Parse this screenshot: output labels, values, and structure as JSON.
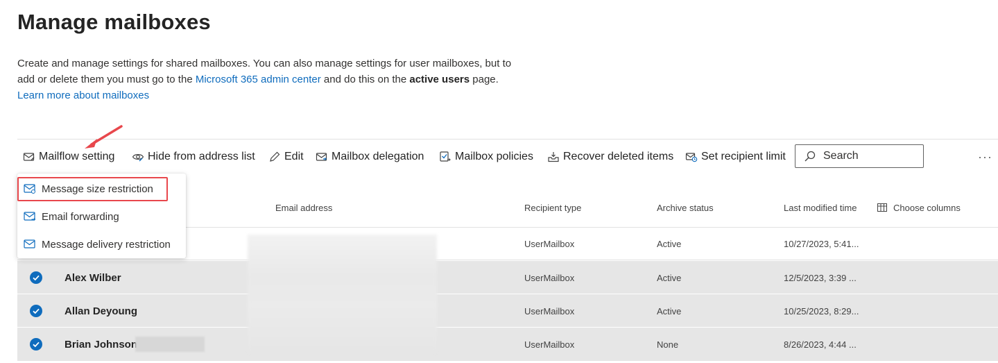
{
  "page": {
    "title": "Manage mailboxes",
    "description_part1": "Create and manage settings for shared mailboxes. You can also manage settings for user mailboxes, but to add or delete them you must go to the ",
    "link_admin_center": "Microsoft 365 admin center",
    "description_part2": " and do this on the ",
    "bold_text": "active users",
    "description_part3": " page. ",
    "link_learn_more": "Learn more about mailboxes"
  },
  "toolbar": {
    "mailflow_setting": "Mailflow setting",
    "hide_from_address_list": "Hide from address list",
    "edit": "Edit",
    "mailbox_delegation": "Mailbox delegation",
    "mailbox_policies": "Mailbox policies",
    "recover_deleted_items": "Recover deleted items",
    "set_recipient_limit": "Set recipient limit",
    "search_placeholder": "Search",
    "more": "···"
  },
  "dropdown": {
    "items": [
      {
        "label": "Message size restriction",
        "icon": "mail-settings-icon"
      },
      {
        "label": "Email forwarding",
        "icon": "mail-forward-icon"
      },
      {
        "label": "Message delivery restriction",
        "icon": "mail-icon"
      }
    ]
  },
  "table": {
    "columns": {
      "email": "Email address",
      "recipient_type": "Recipient type",
      "archive_status": "Archive status",
      "last_modified": "Last modified time",
      "choose_columns": "Choose columns"
    },
    "rows": [
      {
        "name": "",
        "recipient_type": "UserMailbox",
        "archive_status": "Active",
        "last_modified": "10/27/2023, 5:41...",
        "selected": false
      },
      {
        "name": "Alex Wilber",
        "recipient_type": "UserMailbox",
        "archive_status": "Active",
        "last_modified": "12/5/2023, 3:39 ...",
        "selected": true
      },
      {
        "name": "Allan Deyoung",
        "recipient_type": "UserMailbox",
        "archive_status": "Active",
        "last_modified": "10/25/2023, 8:29...",
        "selected": true
      },
      {
        "name": "Brian Johnson",
        "recipient_type": "UserMailbox",
        "archive_status": "None",
        "last_modified": "8/26/2023, 4:44 ...",
        "selected": true
      }
    ]
  },
  "colors": {
    "accent": "#0f6cbd",
    "highlight": "#e8474c",
    "selected_row": "#e6e6e6"
  }
}
